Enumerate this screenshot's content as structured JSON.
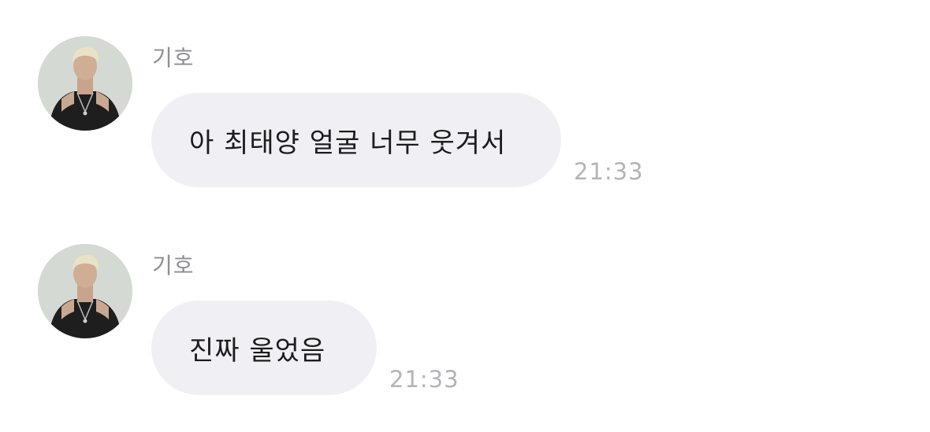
{
  "messages": [
    {
      "sender": "기호",
      "text": "아 최태양 얼굴 너무 웃겨서",
      "time": "21:33"
    },
    {
      "sender": "기호",
      "text": "진짜 울었음",
      "time": "21:33"
    }
  ]
}
